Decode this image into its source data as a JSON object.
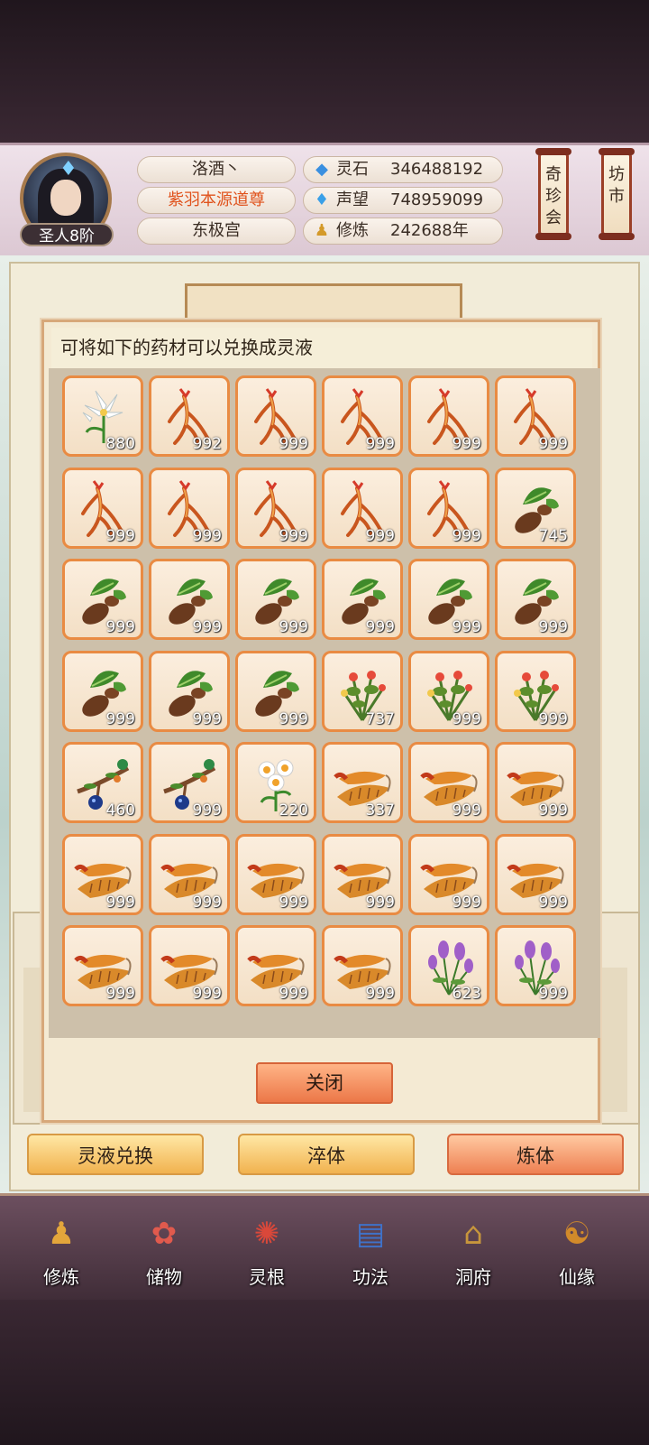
{
  "player": {
    "name": "洛酒丶",
    "title": "紫羽本源道尊",
    "sect": "东极宫",
    "rank": "圣人8阶"
  },
  "stats": [
    {
      "icon": "spirit-stone-icon",
      "glyph": "◆",
      "color": "#3a8fe0",
      "label": "灵石",
      "value": "346488192"
    },
    {
      "icon": "prestige-icon",
      "glyph": "♦",
      "color": "#3aa0e8",
      "label": "声望",
      "value": "748959099"
    },
    {
      "icon": "cultivation-icon",
      "glyph": "♟",
      "color": "#d49a2a",
      "label": "修炼",
      "value": "242688年"
    }
  ],
  "side_buttons": {
    "treasure": "奇珍会",
    "market": "坊市"
  },
  "dialog": {
    "heading": "可将如下的药材可以兑换成灵液",
    "close": "关闭",
    "items": [
      {
        "type": "lily",
        "count": "880"
      },
      {
        "type": "ginseng",
        "count": "992"
      },
      {
        "type": "ginseng",
        "count": "999"
      },
      {
        "type": "ginseng",
        "count": "999"
      },
      {
        "type": "ginseng",
        "count": "999"
      },
      {
        "type": "ginseng",
        "count": "999"
      },
      {
        "type": "ginseng",
        "count": "999"
      },
      {
        "type": "ginseng",
        "count": "999"
      },
      {
        "type": "ginseng",
        "count": "999"
      },
      {
        "type": "ginseng",
        "count": "999"
      },
      {
        "type": "ginseng",
        "count": "999"
      },
      {
        "type": "root",
        "count": "745"
      },
      {
        "type": "root",
        "count": "999"
      },
      {
        "type": "root",
        "count": "999"
      },
      {
        "type": "root",
        "count": "999"
      },
      {
        "type": "root",
        "count": "999"
      },
      {
        "type": "root",
        "count": "999"
      },
      {
        "type": "root",
        "count": "999"
      },
      {
        "type": "root",
        "count": "999"
      },
      {
        "type": "root",
        "count": "999"
      },
      {
        "type": "root",
        "count": "999"
      },
      {
        "type": "herb",
        "count": "737"
      },
      {
        "type": "herb",
        "count": "999"
      },
      {
        "type": "herb",
        "count": "999"
      },
      {
        "type": "berry",
        "count": "460"
      },
      {
        "type": "berry",
        "count": "999"
      },
      {
        "type": "daisy",
        "count": "220"
      },
      {
        "type": "cordyceps",
        "count": "337"
      },
      {
        "type": "cordyceps",
        "count": "999"
      },
      {
        "type": "cordyceps",
        "count": "999"
      },
      {
        "type": "cordyceps",
        "count": "999"
      },
      {
        "type": "cordyceps",
        "count": "999"
      },
      {
        "type": "cordyceps",
        "count": "999"
      },
      {
        "type": "cordyceps",
        "count": "999"
      },
      {
        "type": "cordyceps",
        "count": "999"
      },
      {
        "type": "cordyceps",
        "count": "999"
      },
      {
        "type": "cordyceps",
        "count": "999"
      },
      {
        "type": "cordyceps",
        "count": "999"
      },
      {
        "type": "cordyceps",
        "count": "999"
      },
      {
        "type": "cordyceps",
        "count": "999"
      },
      {
        "type": "lavender",
        "count": "623"
      },
      {
        "type": "lavender",
        "count": "999"
      }
    ]
  },
  "actions": {
    "exchange": "灵液兑换",
    "temper": "淬体",
    "refine": "炼体"
  },
  "nav": [
    {
      "label": "修炼",
      "icon": "cultivate-icon",
      "glyph": "♟",
      "color": "#e3a63b"
    },
    {
      "label": "储物",
      "icon": "bag-icon",
      "glyph": "✿",
      "color": "#e05a4d"
    },
    {
      "label": "灵根",
      "icon": "spirit-root-icon",
      "glyph": "✺",
      "color": "#d9483a"
    },
    {
      "label": "功法",
      "icon": "book-icon",
      "glyph": "▤",
      "color": "#3f72c9"
    },
    {
      "label": "洞府",
      "icon": "cave-icon",
      "glyph": "⌂",
      "color": "#c7963c"
    },
    {
      "label": "仙缘",
      "icon": "gourd-icon",
      "glyph": "☯",
      "color": "#d28a2a"
    }
  ]
}
